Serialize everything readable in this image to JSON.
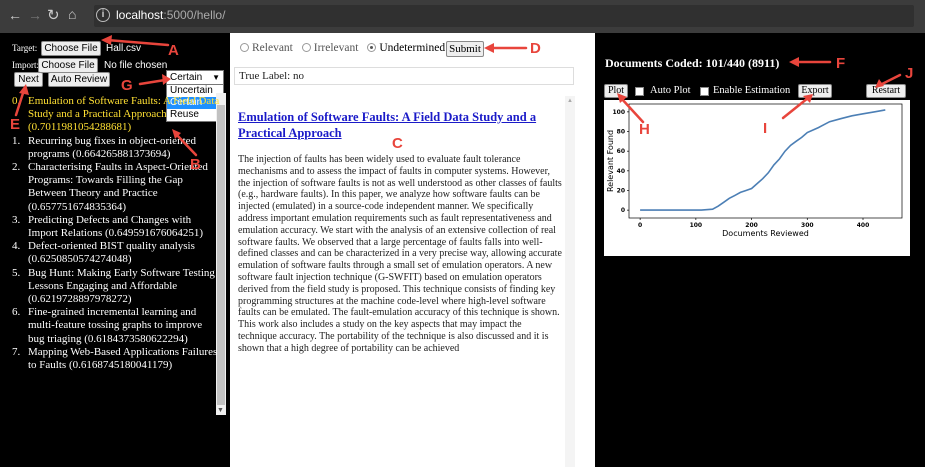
{
  "browser": {
    "url_host": "localhost",
    "url_path": ":5000/hello/",
    "info_icon": "info-icon"
  },
  "left": {
    "target_label": "Target:",
    "target_button": "Choose File",
    "target_file": "Hall.csv",
    "import_label": "Import:",
    "import_button": "Choose File",
    "import_file": "No file chosen",
    "next_button": "Next",
    "auto_review_button": "Auto Review",
    "mode_select_value": "Certain",
    "mode_options": [
      "Uncertain",
      "Certain",
      "Reuse"
    ],
    "mode_selected_index": 1,
    "documents": [
      {
        "num": "0.",
        "title": "Emulation of Software Faults: A Field Data Study and a Practical Approach",
        "score": "(0.7011981054288681)",
        "active": true
      },
      {
        "num": "1.",
        "title": "Recurring bug fixes in object-oriented programs",
        "score": "(0.664265881373694)",
        "active": false
      },
      {
        "num": "2.",
        "title": "Characterising Faults in Aspect-Oriented Programs: Towards Filling the Gap Between Theory and Practice",
        "score": "(0.657751674835364)",
        "active": false
      },
      {
        "num": "3.",
        "title": "Predicting Defects and Changes with Import Relations",
        "score": "(0.649591676064251)",
        "active": false
      },
      {
        "num": "4.",
        "title": "Defect-oriented BIST quality analysis",
        "score": "(0.6250850574274048)",
        "active": false
      },
      {
        "num": "5.",
        "title": "Bug Hunt: Making Early Software Testing Lessons Engaging and Affordable",
        "score": "(0.6219728897978272)",
        "active": false
      },
      {
        "num": "6.",
        "title": "Fine-grained incremental learning and multi-feature tossing graphs to improve bug triaging",
        "score": "(0.6184373580622294)",
        "active": false
      },
      {
        "num": "7.",
        "title": "Mapping Web-Based Applications Failures to Faults",
        "score": "(0.6168745180041179)",
        "active": false
      }
    ]
  },
  "middle": {
    "radio_relevant": "Relevant",
    "radio_irrelevant": "Irrelevant",
    "radio_undetermined": "Undetermined",
    "selected_radio": "Undetermined",
    "submit_button": "Submit",
    "true_label": "True Label: no",
    "doc_title": "Emulation of Software Faults: A Field Data Study and a Practical Approach",
    "doc_abstract": "The injection of faults has been widely used to evaluate fault tolerance mechanisms and to assess the impact of faults in computer systems. However, the injection of software faults is not as well understood as other classes of faults (e.g., hardware faults). In this paper, we analyze how software faults can be injected (emulated) in a source-code independent manner. We specifically address important emulation requirements such as fault representativeness and emulation accuracy. We start with the analysis of an extensive collection of real software faults. We observed that a large percentage of faults falls into well-defined classes and can be characterized in a very precise way, allowing accurate emulation of software faults through a small set of emulation operators. A new software fault injection technique (G-SWFIT) based on emulation operators derived from the field study is proposed. This technique consists of finding key programming structures at the machine code-level where high-level software faults can be emulated. The fault-emulation accuracy of this technique is shown. This work also includes a study on the key aspects that may impact the technique accuracy. The portability of the technique is also discussed and it is shown that a high degree of portability can be achieved"
  },
  "right": {
    "coded_text": "Documents Coded: 101/440 (8911)",
    "plot_button": "Plot",
    "auto_plot_label": "Auto Plot",
    "enable_estimation_label": "Enable Estimation",
    "export_button": "Export",
    "restart_button": "Restart"
  },
  "annotations": {
    "a": "A",
    "b": "B",
    "c": "C",
    "d": "D",
    "e": "E",
    "f": "F",
    "g": "G",
    "h": "H",
    "i": "I",
    "j": "J",
    "color": "#e8453c"
  },
  "chart_data": {
    "type": "line",
    "xlabel": "Documents Reviewed",
    "ylabel": "Relevant Found",
    "xlim": [
      -20,
      470
    ],
    "ylim": [
      -8,
      108
    ],
    "xticks": [
      0,
      100,
      200,
      300,
      400
    ],
    "yticks": [
      0,
      20,
      40,
      60,
      80,
      100
    ],
    "line_color": "#4c7fb5",
    "x": [
      0,
      60,
      110,
      130,
      140,
      150,
      160,
      170,
      180,
      190,
      200,
      210,
      220,
      230,
      240,
      250,
      260,
      270,
      280,
      290,
      300,
      320,
      340,
      360,
      380,
      400,
      420,
      440
    ],
    "y": [
      0,
      0,
      0,
      1,
      4,
      8,
      12,
      15,
      18,
      20,
      22,
      27,
      32,
      38,
      46,
      52,
      60,
      66,
      70,
      74,
      79,
      84,
      90,
      93,
      96,
      98,
      100,
      102
    ]
  }
}
